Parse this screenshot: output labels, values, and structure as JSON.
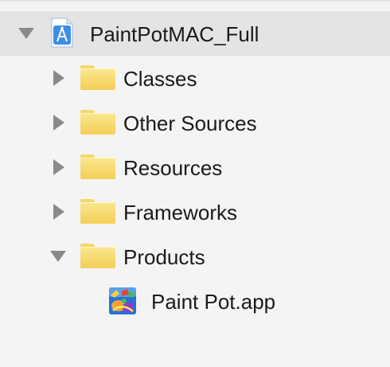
{
  "navigator": {
    "project": {
      "name": "PaintPotMAC_Full",
      "icon": "xcode-project-icon",
      "expanded": true
    },
    "groups": [
      {
        "label": "Classes",
        "icon": "folder-icon",
        "expanded": false
      },
      {
        "label": "Other Sources",
        "icon": "folder-icon",
        "expanded": false
      },
      {
        "label": "Resources",
        "icon": "folder-icon",
        "expanded": false
      },
      {
        "label": "Frameworks",
        "icon": "folder-icon",
        "expanded": false
      },
      {
        "label": "Products",
        "icon": "folder-icon",
        "expanded": true
      }
    ],
    "product_file": {
      "label": "Paint Pot.app",
      "icon": "app-icon"
    }
  },
  "colors": {
    "background": "#f4f4f4",
    "selected_row": "#e4e4e4",
    "folder": "#f3cf55",
    "disclosure": "#8a8a8a",
    "project_icon": "#3b8ee8"
  }
}
